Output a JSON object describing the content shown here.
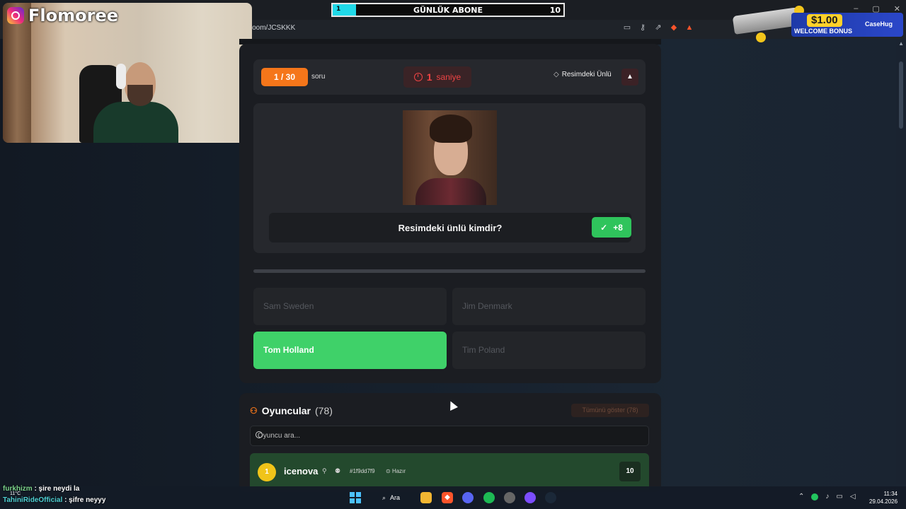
{
  "overlay": {
    "goal": {
      "title": "GÜNLÜK ABONE",
      "current": "1",
      "target": "10",
      "progress_fraction": 0.1
    },
    "webcam": {
      "name": "Flomoree"
    },
    "ad": {
      "amount": "$1.00",
      "bonus_text": "WELCOME BONUS",
      "brand": "CaseHug"
    },
    "chat": [
      {
        "user": "furkhizm",
        "message": ": şire neydi la"
      },
      {
        "user": "TahiniRideOfficial",
        "message": ": şifre neyyy"
      }
    ],
    "weather": "11°C"
  },
  "browser": {
    "url": "/room/JCSKKK"
  },
  "game": {
    "question_counter": "1 / 30",
    "question_label": "soru",
    "timer_value": "1",
    "timer_unit": "saniye",
    "category": "Resimdeki Ünlü",
    "question_text": "Resimdeki ünlü kimdir?",
    "points": "+8",
    "answers": [
      {
        "label": "Sam Sweden",
        "state": "neutral"
      },
      {
        "label": "Jim Denmark",
        "state": "neutral"
      },
      {
        "label": "Tom Holland",
        "state": "correct"
      },
      {
        "label": "Tim Poland",
        "state": "neutral"
      }
    ]
  },
  "players": {
    "title": "Oyuncular",
    "count": "(78)",
    "show_all": "Tümünü göster (78)",
    "search_placeholder": "Oyuncu ara...",
    "rows": [
      {
        "rank": "1",
        "name": "icenova",
        "id": "#1f9dd7f9",
        "status": "Hazır",
        "score": "10"
      }
    ]
  },
  "taskbar": {
    "search_label": "Ara",
    "time": "11:34",
    "date": "29.04.2026"
  },
  "colors": {
    "accent_orange": "#f5761a",
    "correct_green": "#3fd169",
    "timer_red": "#ef4444"
  }
}
